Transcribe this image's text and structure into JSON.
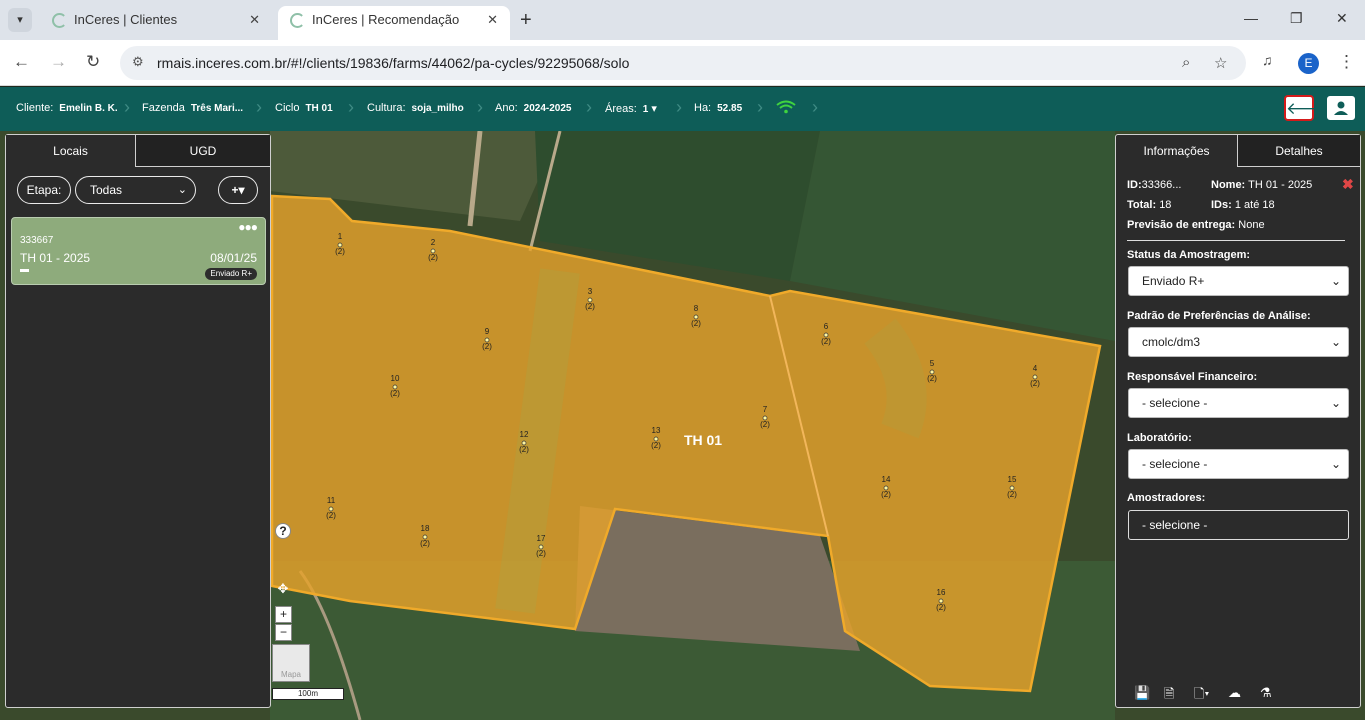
{
  "browser": {
    "tabs": [
      {
        "title": "InCeres | Clientes",
        "active": false
      },
      {
        "title": "InCeres | Recomendação",
        "active": true
      }
    ],
    "url": "rmais.inceres.com.br/#!/clients/19836/farms/44062/pa-cycles/92295068/solo",
    "profile_initial": "E"
  },
  "header": {
    "cliente_label": "Cliente:",
    "cliente_value": "Emelin B. K.",
    "fazenda_label": "Fazenda",
    "fazenda_value": "Três Mari...",
    "ciclo_label": "Ciclo",
    "ciclo_value": "TH 01",
    "cultura_label": "Cultura:",
    "cultura_value": "soja_milho",
    "ano_label": "Ano:",
    "ano_value": "2024-2025",
    "areas_label": "Áreas:",
    "areas_value": "1",
    "ha_label": "Ha:",
    "ha_value": "52.85",
    "colors": {
      "bar": "#0e5d58",
      "wifi": "#3fd33f"
    }
  },
  "left_panel": {
    "tabs": [
      "Locais",
      "UGD"
    ],
    "etapa_label": "Etapa:",
    "etapa_select": "Todas",
    "add_button": "+▾",
    "card": {
      "id": "333667",
      "name": "TH 01 - 2025",
      "date": "08/01/25",
      "status": "Enviado R+"
    }
  },
  "map": {
    "field_label": "TH 01",
    "scale_label": "100m",
    "layer_button": "Mapa",
    "help": "?",
    "zoom_in": "+",
    "zoom_out": "−",
    "points": [
      {
        "n": "1",
        "c": "(2)"
      },
      {
        "n": "2",
        "c": "(2)"
      },
      {
        "n": "3",
        "c": "(2)"
      },
      {
        "n": "4",
        "c": "(2)"
      },
      {
        "n": "5",
        "c": "(2)"
      },
      {
        "n": "6",
        "c": "(2)"
      },
      {
        "n": "7",
        "c": "(2)"
      },
      {
        "n": "8",
        "c": "(2)"
      },
      {
        "n": "9",
        "c": "(2)"
      },
      {
        "n": "10",
        "c": "(2)"
      },
      {
        "n": "11",
        "c": "(2)"
      },
      {
        "n": "12",
        "c": "(2)"
      },
      {
        "n": "13",
        "c": "(2)"
      },
      {
        "n": "14",
        "c": "(2)"
      },
      {
        "n": "15",
        "c": "(2)"
      },
      {
        "n": "16",
        "c": "(2)"
      },
      {
        "n": "17",
        "c": "(2)"
      },
      {
        "n": "18",
        "c": "(2)"
      }
    ]
  },
  "right_panel": {
    "tabs": [
      "Informações",
      "Detalhes"
    ],
    "id_label": "ID:",
    "id_value": "33366...",
    "nome_label": "Nome:",
    "nome_value": "TH 01 - 2025",
    "total_label": "Total:",
    "total_value": "18",
    "ids_label": "IDs:",
    "ids_value": "1 até 18",
    "previsao_label": "Previsão de entrega:",
    "previsao_value": "None",
    "status_label": "Status da Amostragem:",
    "status_value": "Enviado R+",
    "padrao_label": "Padrão de Preferências de Análise:",
    "padrao_value": "cmolc/dm3",
    "responsavel_label": "Responsável Financeiro:",
    "responsavel_value": "- selecione -",
    "laboratorio_label": "Laboratório:",
    "laboratorio_value": "- selecione -",
    "amostradores_label": "Amostradores:",
    "amostradores_value": "- selecione -"
  }
}
